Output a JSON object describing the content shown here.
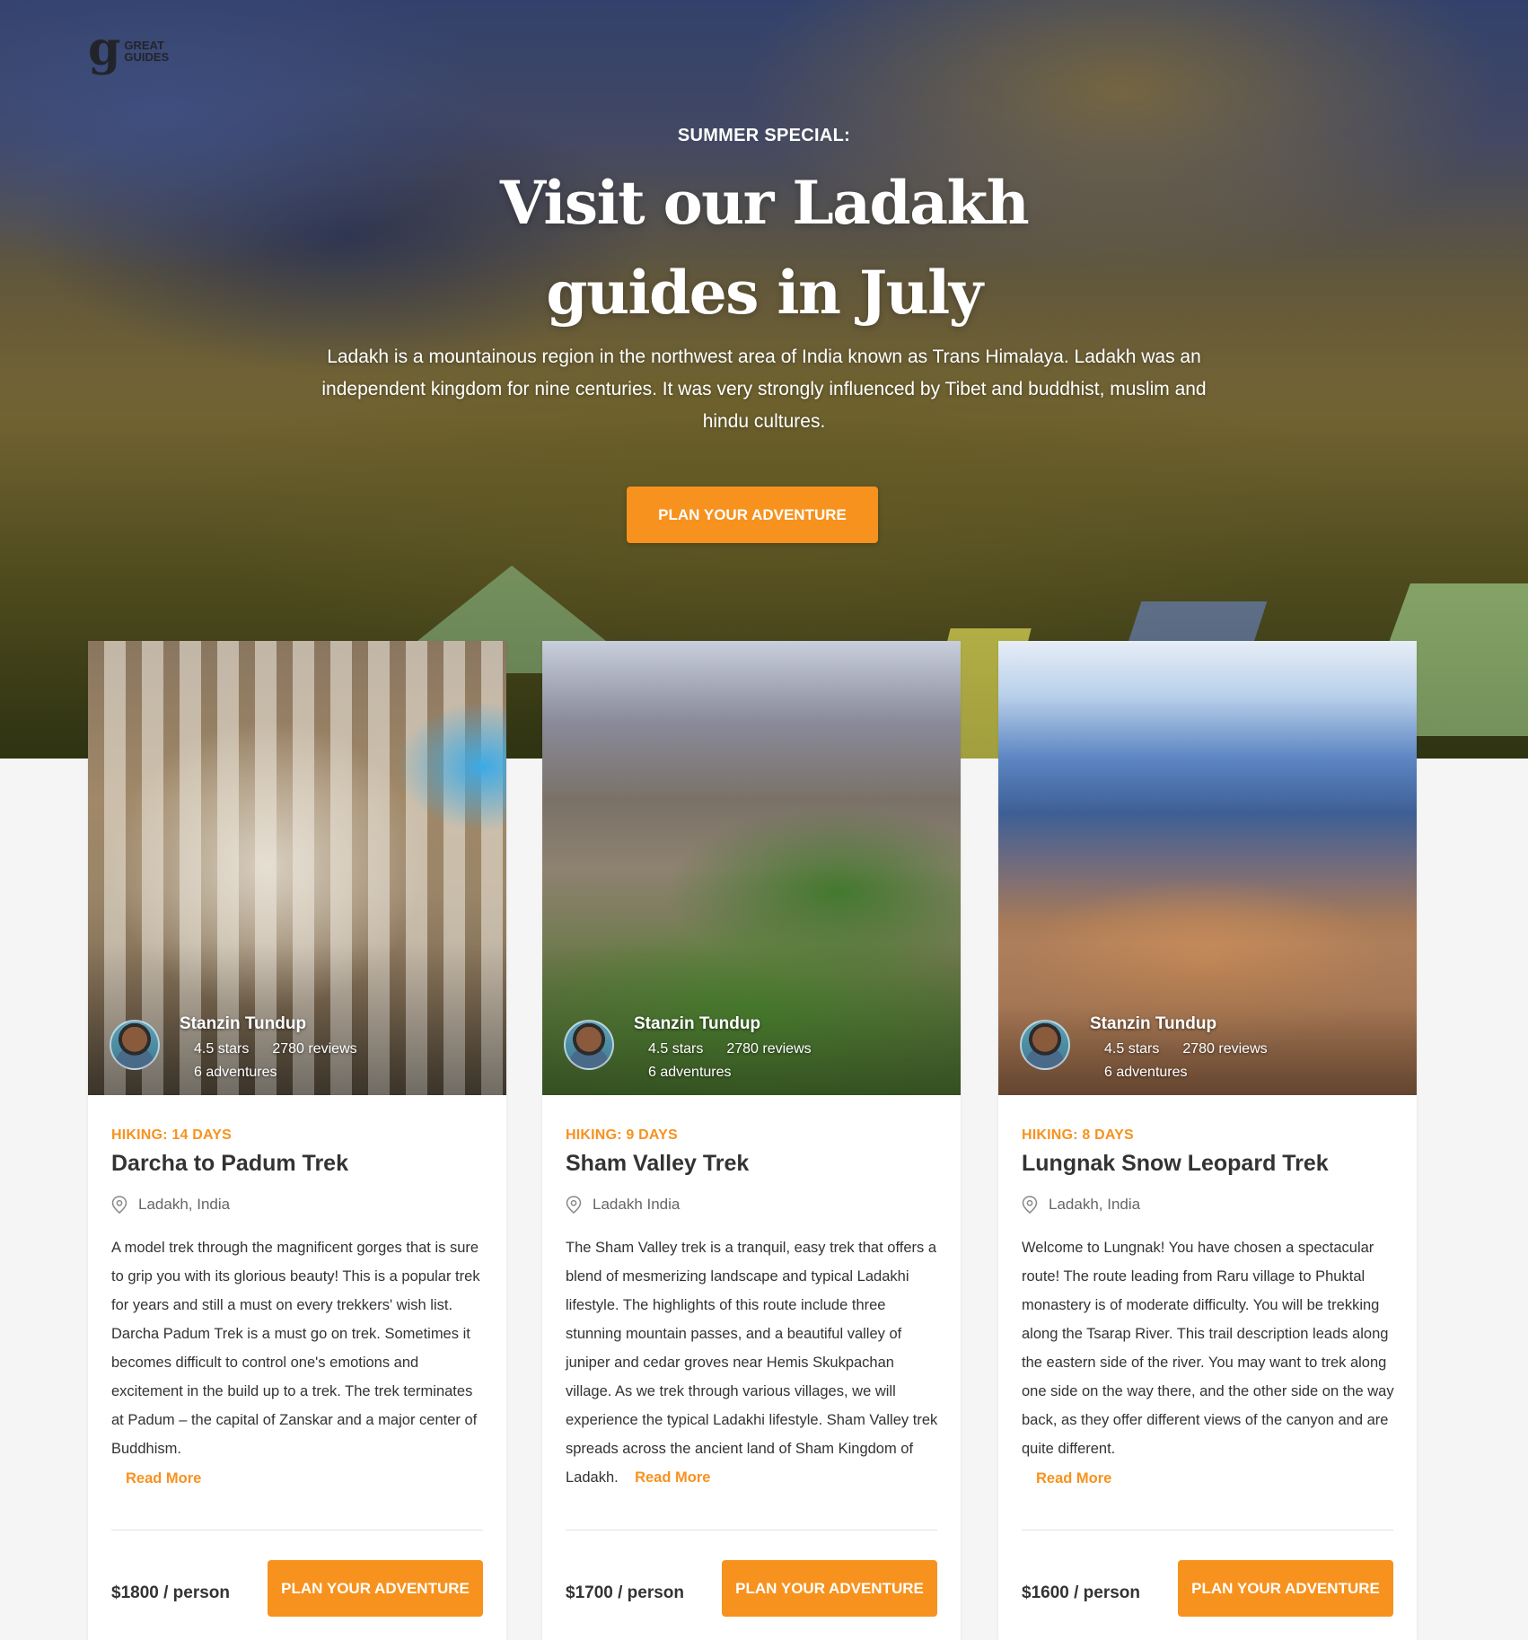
{
  "brand": {
    "logo_mark": "g",
    "logo_text_line1": "GREAT",
    "logo_text_line2": "GUIDES"
  },
  "hero": {
    "eyebrow": "SUMMER SPECIAL:",
    "title_line1": "Visit our Ladakh",
    "title_line2": "guides in July",
    "description": "Ladakh is a mountainous region in the northwest area of India known as Trans Himalaya. Ladakh was an independent kingdom for nine centuries. It was very strongly influenced by Tibet and buddhist, muslim and hindu cultures.",
    "cta_label": "PLAN YOUR ADVENTURE"
  },
  "icons": {
    "location": "map-pin-icon"
  },
  "colors": {
    "accent": "#f7921e",
    "background": "#f5f5f5"
  },
  "cards": [
    {
      "guide": {
        "name": "Stanzin Tundup",
        "stars": "4.5 stars",
        "reviews": "2780 reviews",
        "adventures": "6 adventures"
      },
      "category": "HIKING: 14 DAYS",
      "title": "Darcha to Padum Trek",
      "location": "Ladakh, India",
      "description": "A model trek through the magnificent gorges that is sure to grip you with its glorious beauty! This is a popular trek for years and still a must on every trekkers' wish list. Darcha Padum Trek is a must go on trek. Sometimes it becomes difficult to control one's emotions and excitement in the build up to a trek. The trek terminates at Padum – the capital of Zanskar and a major center of Buddhism.",
      "read_more": "Read More",
      "price": "$1800 / person",
      "cta_label": "PLAN YOUR ADVENTURE"
    },
    {
      "guide": {
        "name": "Stanzin Tundup",
        "stars": "4.5 stars",
        "reviews": "2780 reviews",
        "adventures": "6 adventures"
      },
      "category": "HIKING: 9 DAYS",
      "title": "Sham Valley Trek",
      "location": "Ladakh India",
      "description": "The Sham Valley trek is a tranquil, easy trek that offers a blend of mesmerizing landscape and typical Ladakhi lifestyle. The highlights of this route include three stunning mountain passes, and a beautiful valley of juniper and cedar groves near Hemis Skukpachan village. As we trek through various villages, we will experience the typical Ladakhi lifestyle. Sham Valley trek spreads across the ancient land of Sham Kingdom of Ladakh.",
      "read_more": "Read More",
      "price": "$1700 / person",
      "cta_label": "PLAN YOUR ADVENTURE"
    },
    {
      "guide": {
        "name": "Stanzin Tundup",
        "stars": "4.5 stars",
        "reviews": "2780 reviews",
        "adventures": "6 adventures"
      },
      "category": "HIKING: 8 DAYS",
      "title": "Lungnak Snow Leopard Trek",
      "location": "Ladakh, India",
      "description": "Welcome to Lungnak! You have chosen a spectacular route! The route leading from Raru village to Phuktal monastery is of moderate difficulty. You will be trekking along the Tsarap River. This trail description leads along the eastern side of the river. You may want to trek along one side on the way there, and the other side on the way back, as they offer different views of the canyon and are quite different.",
      "read_more": "Read More",
      "price": "$1600 / person",
      "cta_label": "PLAN YOUR ADVENTURE"
    }
  ]
}
